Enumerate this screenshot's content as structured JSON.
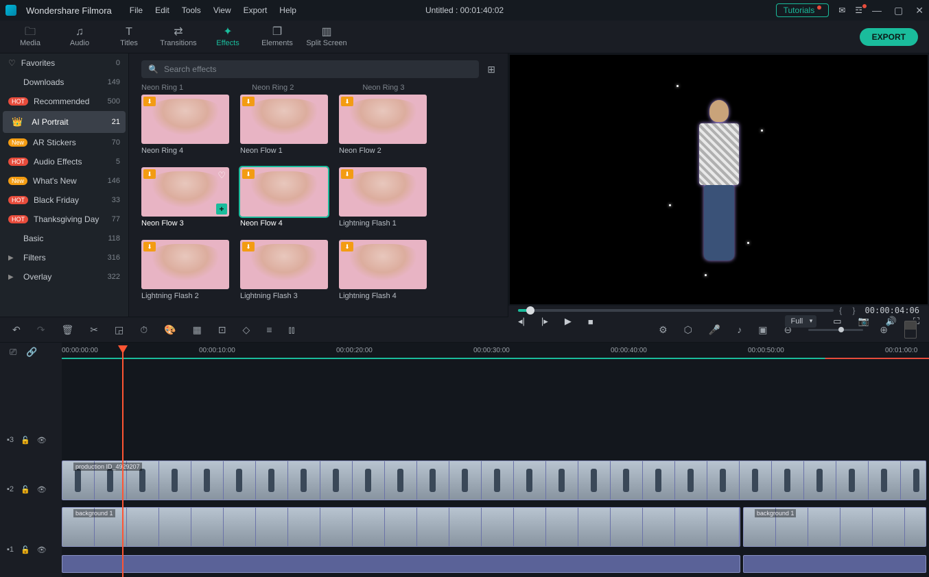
{
  "app_title": "Wondershare Filmora",
  "menus": [
    "File",
    "Edit",
    "Tools",
    "View",
    "Export",
    "Help"
  ],
  "doc_title": "Untitled : 00:01:40:02",
  "tutorials_label": "Tutorials",
  "nav": [
    {
      "label": "Media",
      "icon": "🗀"
    },
    {
      "label": "Audio",
      "icon": "♫"
    },
    {
      "label": "Titles",
      "icon": "T"
    },
    {
      "label": "Transitions",
      "icon": "⇄"
    },
    {
      "label": "Effects",
      "icon": "✦",
      "active": true
    },
    {
      "label": "Elements",
      "icon": "❐"
    },
    {
      "label": "Split Screen",
      "icon": "▥"
    }
  ],
  "export_label": "EXPORT",
  "search_placeholder": "Search effects",
  "sidebar": [
    {
      "label": "Favorites",
      "count": "0",
      "icon": "heart"
    },
    {
      "label": "Downloads",
      "count": "149"
    },
    {
      "label": "Recommended",
      "count": "500",
      "badge": "hot"
    },
    {
      "label": "AI Portrait",
      "count": "21",
      "badge": "crown",
      "active": true
    },
    {
      "label": "AR Stickers",
      "count": "70",
      "badge": "new"
    },
    {
      "label": "Audio Effects",
      "count": "5",
      "badge": "hot"
    },
    {
      "label": "What's New",
      "count": "146",
      "badge": "new"
    },
    {
      "label": "Black Friday",
      "count": "33",
      "badge": "hot"
    },
    {
      "label": "Thanksgiving Day",
      "count": "77",
      "badge": "hot"
    },
    {
      "label": "Basic",
      "count": "118"
    },
    {
      "label": "Filters",
      "count": "316",
      "chev": true
    },
    {
      "label": "Overlay",
      "count": "322",
      "chev": true
    }
  ],
  "partial_row": [
    "Neon Ring 1",
    "Neon Ring 2",
    "Neon Ring 3"
  ],
  "effects": [
    {
      "name": "Neon Ring 4"
    },
    {
      "name": "Neon Flow 1"
    },
    {
      "name": "Neon Flow 2"
    },
    {
      "name": "Neon Flow 3",
      "hover": true
    },
    {
      "name": "Neon Flow 4",
      "selected": true
    },
    {
      "name": "Lightning Flash 1"
    },
    {
      "name": "Lightning Flash 2"
    },
    {
      "name": "Lightning Flash 3"
    },
    {
      "name": "Lightning Flash 4"
    }
  ],
  "preview": {
    "timecode": "00:00:04:06",
    "quality": "Full"
  },
  "ruler": [
    "00:00:00:00",
    "00:00:10:00",
    "00:00:20:00",
    "00:00:30:00",
    "00:00:40:00",
    "00:00:50:00",
    "00:01:00:0"
  ],
  "tracks": {
    "t3": "3",
    "t2": "2",
    "t1": "1"
  },
  "clips": {
    "video": "production ID_4929207",
    "bg1": "background 1",
    "bg2": "background 1"
  }
}
